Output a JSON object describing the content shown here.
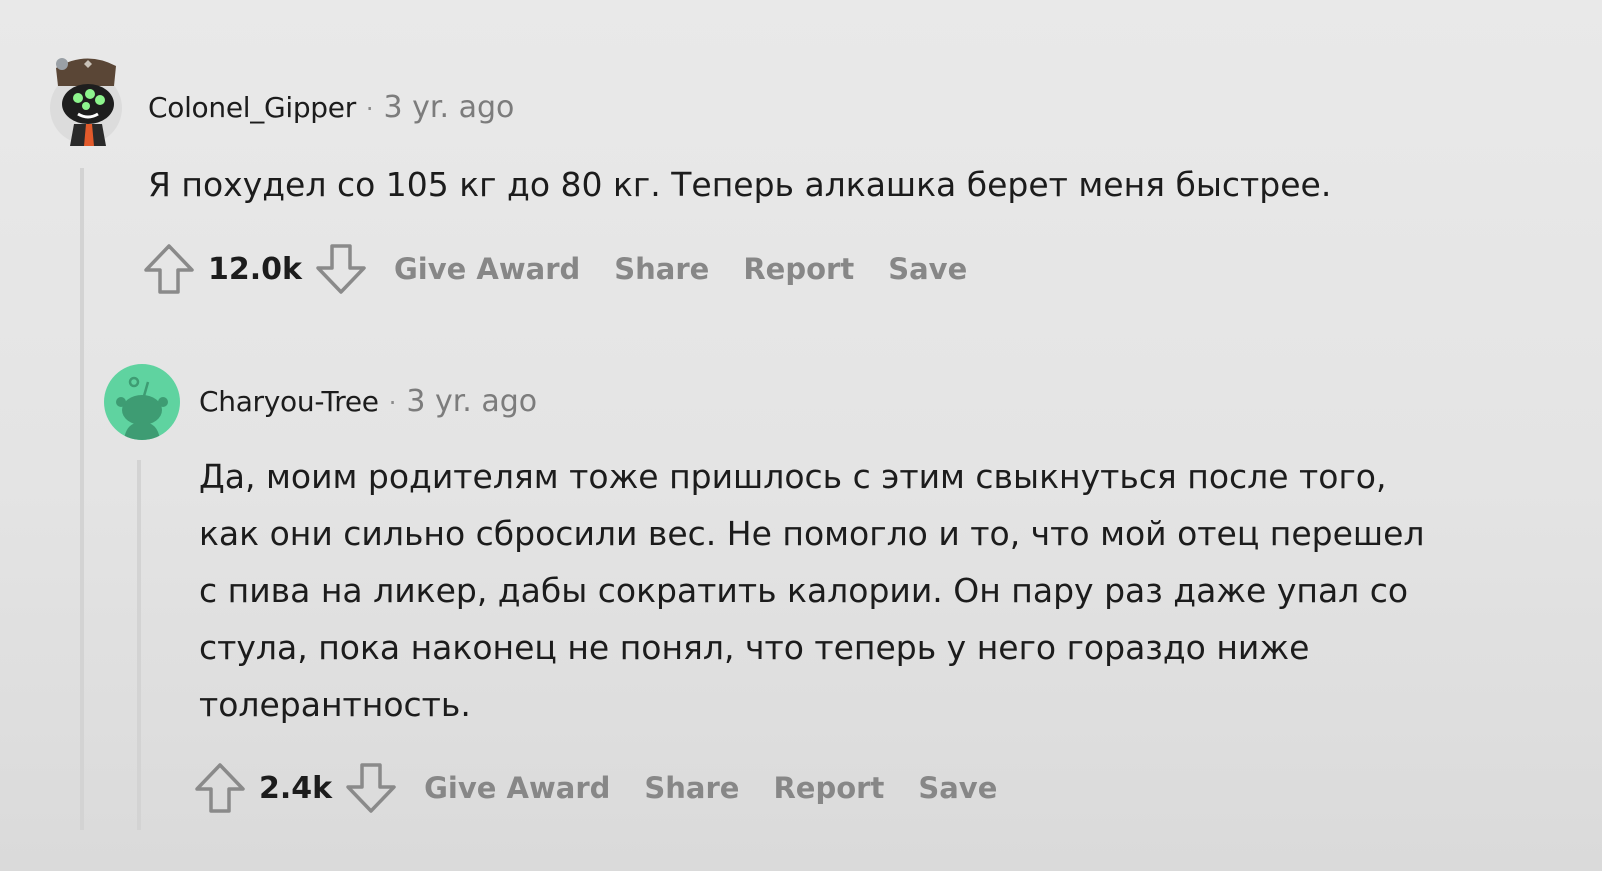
{
  "comments": [
    {
      "username": "Colonel_Gipper",
      "separator": "·",
      "time": "3 yr. ago",
      "avatar": "snoo-avatar-helmet-goggles",
      "body": "Я похудел со 105 кг до 80 кг. Теперь алкашка берет меня быстрее.",
      "score": "12.0k",
      "actions": {
        "upvote_icon": "upvote-arrow-icon",
        "downvote_icon": "downvote-arrow-icon",
        "award": "Give Award",
        "share": "Share",
        "report": "Report",
        "save": "Save"
      }
    },
    {
      "username": "Charyou-Tree",
      "separator": "·",
      "time": "3 yr. ago",
      "avatar": "default-snoo-avatar",
      "body_lines": [
        "Да, моим родителям тоже пришлось с этим свыкнуться после того,",
        "как они сильно сбросили вес. Не помогло и то, что мой отец перешел",
        "с пива на ликер, дабы сократить калории. Он пару раз даже упал со",
        "стула, пока наконец не понял, что теперь у него гораздо ниже",
        "толерантность."
      ],
      "score": "2.4k",
      "actions": {
        "upvote_icon": "upvote-arrow-icon",
        "downvote_icon": "downvote-arrow-icon",
        "award": "Give Award",
        "share": "Share",
        "report": "Report",
        "save": "Save"
      }
    }
  ],
  "colors": {
    "background": "#e6e6e6",
    "text": "#1c1c1c",
    "muted": "#878787",
    "thread_line": "#d3d3d3",
    "avatar_green": "#5fd3a0"
  }
}
